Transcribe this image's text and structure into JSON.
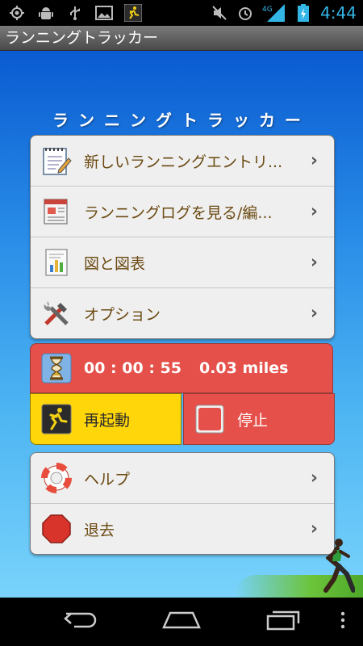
{
  "status_bar": {
    "time": "4:44",
    "network": "4G",
    "left_icons": [
      "gps-icon",
      "android-debug-icon",
      "usb-icon",
      "gallery-icon",
      "runner-notification-icon"
    ],
    "right_icons": [
      "mute-icon",
      "alarm-icon",
      "signal-icon",
      "battery-charging-icon"
    ]
  },
  "title_bar": {
    "title": "ランニングトラッカー"
  },
  "banner": {
    "text": "ランニングトラッカー"
  },
  "main_menu": [
    {
      "label": "新しいランニングエントリ...",
      "icon": "notepad-icon"
    },
    {
      "label": "ランニングログを見る/編...",
      "icon": "log-document-icon"
    },
    {
      "label": "図と図表",
      "icon": "chart-document-icon"
    },
    {
      "label": "オプション",
      "icon": "tools-icon"
    }
  ],
  "tracker": {
    "timer": "00 : 00 : 55",
    "distance": "0.03 miles",
    "restart_label": "再起動",
    "stop_label": "停止"
  },
  "bottom_menu": [
    {
      "label": "ヘルプ",
      "icon": "lifebuoy-icon"
    },
    {
      "label": "退去",
      "icon": "stop-sign-icon"
    }
  ],
  "colors": {
    "accent_red": "#e5504a",
    "accent_yellow": "#ffd60a",
    "label_brown": "#6b4a12",
    "clock_blue": "#33b5e5"
  }
}
